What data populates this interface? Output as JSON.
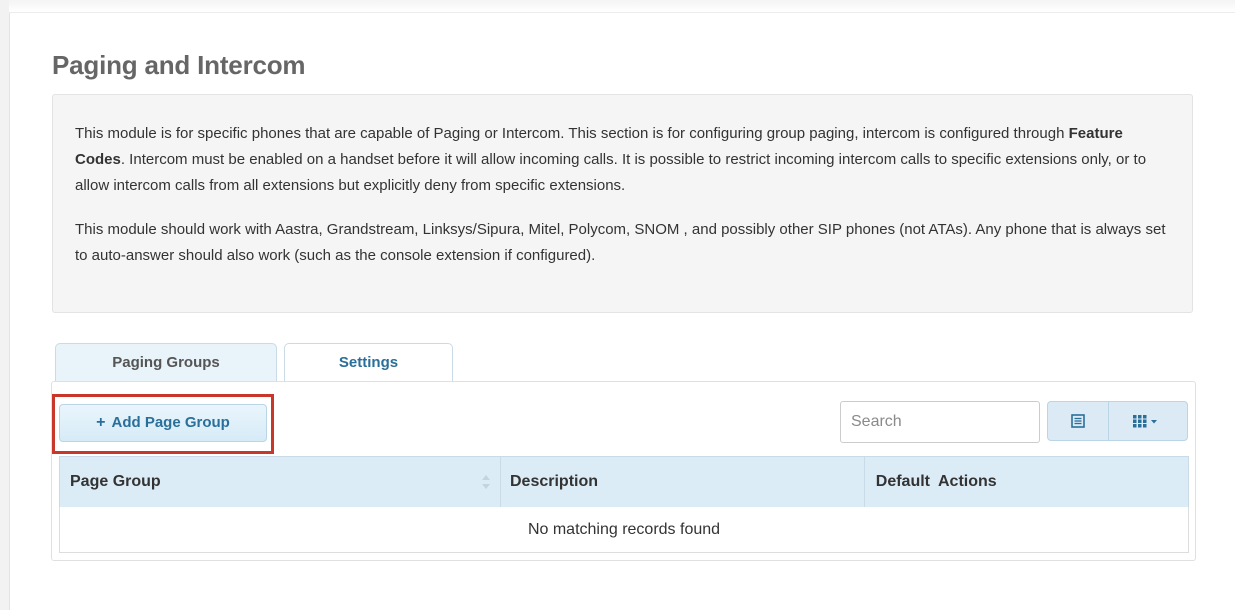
{
  "page": {
    "title": "Paging and Intercom"
  },
  "info": {
    "para1_part1": "This module is for specific phones that are capable of Paging or Intercom. This section is for configuring group paging, intercom is configured through ",
    "para1_bold": "Feature Codes",
    "para1_part2": ". Intercom must be enabled on a handset before it will allow incoming calls. It is possible to restrict incoming intercom calls to specific extensions only, or to allow intercom calls from all extensions but explicitly deny from specific extensions.",
    "para2": "This module should work with Aastra, Grandstream, Linksys/Sipura, Mitel, Polycom, SNOM , and possibly other SIP phones (not ATAs). Any phone that is always set to auto-answer should also work (such as the console extension if configured)."
  },
  "tabs": [
    {
      "label": "Paging Groups",
      "active": true
    },
    {
      "label": "Settings",
      "active": false
    }
  ],
  "toolbar": {
    "add_button_icon": "+",
    "add_button_label": "Add Page Group",
    "search_placeholder": "Search",
    "list_view_icon": "list-icon",
    "columns_icon": "grid-dropdown-icon"
  },
  "table": {
    "columns": [
      "Page Group",
      "Description",
      "Default",
      "Actions"
    ],
    "empty_message": "No matching records found"
  },
  "colors": {
    "accent": "#2a6f9a",
    "highlight_border": "#c8372a",
    "header_bg": "#dcecf6"
  }
}
